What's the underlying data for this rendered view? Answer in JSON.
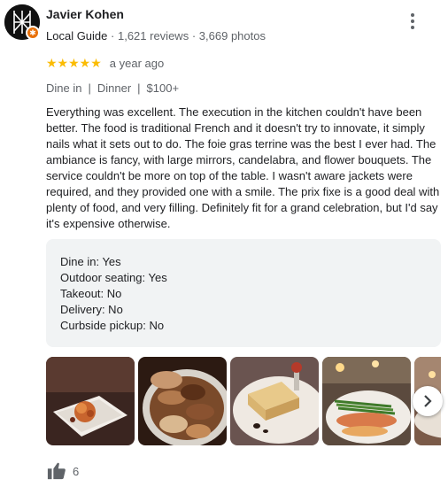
{
  "reviewer": {
    "name": "Javier Kohen",
    "guide_label": "Local Guide",
    "reviews": "1,621 reviews",
    "photos": "3,669 photos",
    "separator": "·",
    "avatar_icon": "geometric-monogram-icon",
    "badge_icon": "local-guide-star-icon"
  },
  "review": {
    "stars": "★★★★★",
    "rating": 5,
    "time_ago": "a year ago",
    "tags": [
      "Dine in",
      "Dinner",
      "$100+"
    ],
    "tag_separator": "|",
    "text": "Everything was excellent. The execution in the kitchen couldn't have been better. The food is traditional French and it doesn't try to innovate, it simply nails what it sets out to do. The foie gras terrine was the best I ever had. The ambiance is fancy, with large mirrors, candelabra, and flower bouquets. The service couldn't be more on top of the table. I wasn't aware jackets were required, and they provided one with a smile. The prix fixe is a good deal with plenty of food, and very filling. Definitely fit for a grand celebration, but I'd say it's expensive otherwise."
  },
  "attributes": [
    "Dine in: Yes",
    "Outdoor seating: Yes",
    "Takeout: No",
    "Delivery: No",
    "Curbside pickup: No"
  ],
  "photos": [
    {
      "name": "photo-plated-appetizer"
    },
    {
      "name": "photo-pastry-plate"
    },
    {
      "name": "photo-foie-gras-terrine"
    },
    {
      "name": "photo-fish-with-asparagus"
    },
    {
      "name": "photo-dining-room"
    }
  ],
  "likes": {
    "count": "6",
    "icon": "thumbs-up-icon"
  },
  "colors": {
    "star": "#fbbc04",
    "meta_text": "#5f6368",
    "attr_bg": "#f1f3f4",
    "badge": "#e8710a"
  }
}
